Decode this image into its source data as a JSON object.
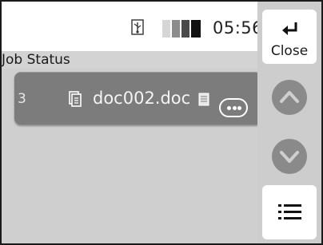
{
  "status_bar": {
    "time": "05:56",
    "icons": [
      "usb-icon",
      "battery-icon"
    ]
  },
  "header": {
    "title": "Job Status"
  },
  "job_list": {
    "jobs": [
      {
        "id": "3",
        "document_name": "doc002.doc",
        "icons": [
          "document-icon",
          "page-icon",
          "more-options-icon"
        ]
      }
    ]
  },
  "side_panel": {
    "close_label": "Close",
    "icons": [
      "return-arrow-icon",
      "scroll-up-icon",
      "scroll-down-icon",
      "list-view-icon"
    ]
  },
  "colors": {
    "job_row": "#7c7c7c",
    "background": "#cfcfcf",
    "button_face": "#ffffff",
    "scroll_button": "#8a8a8a"
  }
}
